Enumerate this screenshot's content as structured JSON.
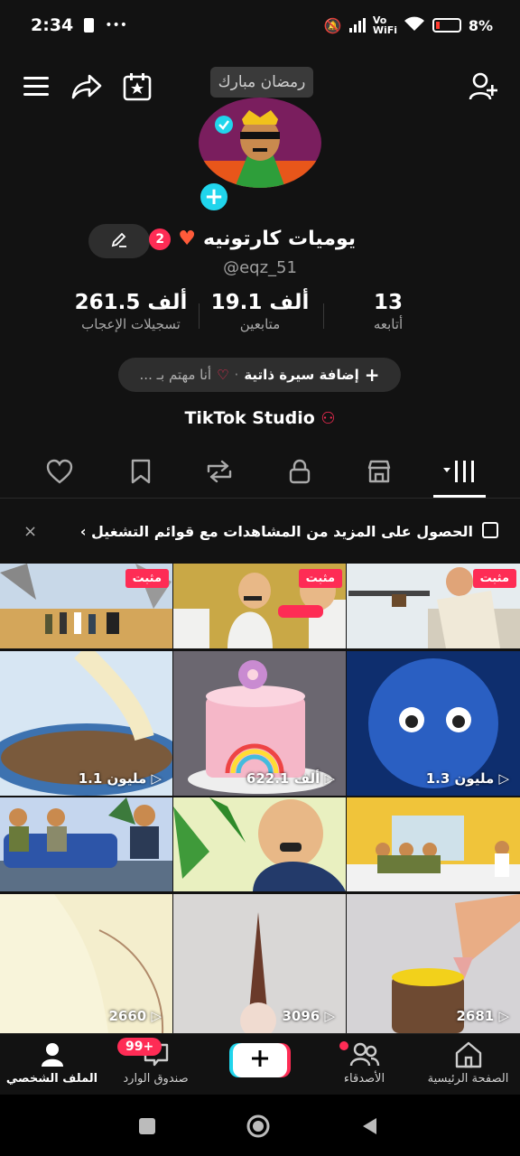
{
  "status_bar": {
    "time": "2:34",
    "dots": "•••",
    "network": "Vo WiFi",
    "battery": "8%"
  },
  "header": {
    "ramadan_tag": "رمضان مبارك"
  },
  "profile": {
    "name": "يوميات كارتونيه",
    "badge_count": "2",
    "handle": "@eqz_51",
    "stats": [
      {
        "value": "13",
        "label": "أتابعه"
      },
      {
        "value": "19.1 ألف",
        "label": "متابعين"
      },
      {
        "value": "261.5 ألف",
        "label": "تسجيلات الإعجاب"
      }
    ],
    "bio_add": "إضافة سيرة ذاتية",
    "bio_interest": "أنا مهتم بـ ...",
    "studio": "TikTok Studio"
  },
  "banner": {
    "text": "الحصول على المزيد من المشاهدات مع قوائم التشغيل ›",
    "close": "×"
  },
  "videos": [
    {
      "pinned": "مثبت",
      "views": ""
    },
    {
      "pinned": "مثبت",
      "views": ""
    },
    {
      "pinned": "مثبت",
      "views": ""
    },
    {
      "pinned": "",
      "views": "1.1 مليون ▷"
    },
    {
      "pinned": "",
      "views": "622.1 ألف ▷"
    },
    {
      "pinned": "",
      "views": "1.3 مليون ▷"
    },
    {
      "pinned": "",
      "views": "2660 ▷"
    },
    {
      "pinned": "",
      "views": "3096 ▷"
    },
    {
      "pinned": "",
      "views": "2681 ▷"
    }
  ],
  "bottom_nav": {
    "profile": "الملف الشخصي",
    "inbox": "صندوق الوارد",
    "inbox_badge": "99+",
    "friends": "الأصدقاء",
    "home": "الصفحة الرئيسية"
  }
}
